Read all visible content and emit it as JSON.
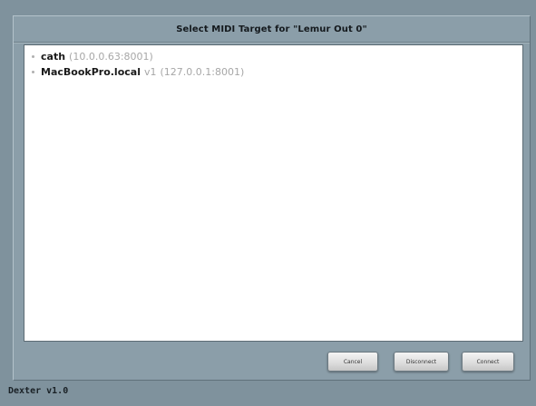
{
  "dialog": {
    "title": "Select MIDI Target for \"Lemur Out 0\""
  },
  "targets": [
    {
      "name": "cath",
      "version": "",
      "address": "(10.0.0.63:8001)"
    },
    {
      "name": "MacBookPro.local",
      "version": "v1",
      "address": "(127.0.0.1:8001)"
    }
  ],
  "buttons": {
    "cancel": "Cancel",
    "disconnect": "Disconnect",
    "connect": "Connect"
  },
  "footer": {
    "app_version": "Dexter v1.0"
  },
  "colors": {
    "background": "#7f929d",
    "panel": "#ffffff",
    "muted_text": "#a7a7a7"
  }
}
